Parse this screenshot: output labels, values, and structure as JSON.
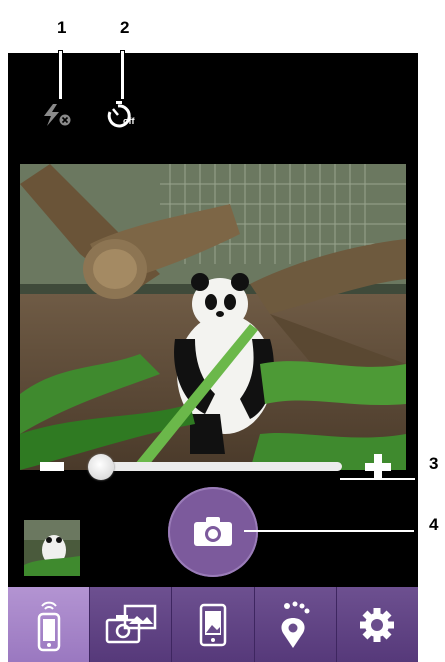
{
  "callouts": {
    "flash": "1",
    "timer": "2",
    "zoom": "3",
    "shutter": "4"
  },
  "status_icons": {
    "flash_icon": "flash-off-icon",
    "timer_icon": "timer-off-icon",
    "timer_off_label": "off"
  },
  "zoom": {
    "level": 0.0
  },
  "nav": {
    "items": [
      {
        "icon": "phone-camera-icon",
        "active": true
      },
      {
        "icon": "camera-gallery-icon",
        "active": false
      },
      {
        "icon": "phone-picture-icon",
        "active": false
      },
      {
        "icon": "location-pin-icon",
        "active": false
      },
      {
        "icon": "settings-gear-icon",
        "active": false
      }
    ]
  },
  "colors": {
    "accent": "#7c5a9c",
    "nav_active": "#a888c8",
    "nav_inactive": "#5f4385",
    "background": "#000000"
  }
}
